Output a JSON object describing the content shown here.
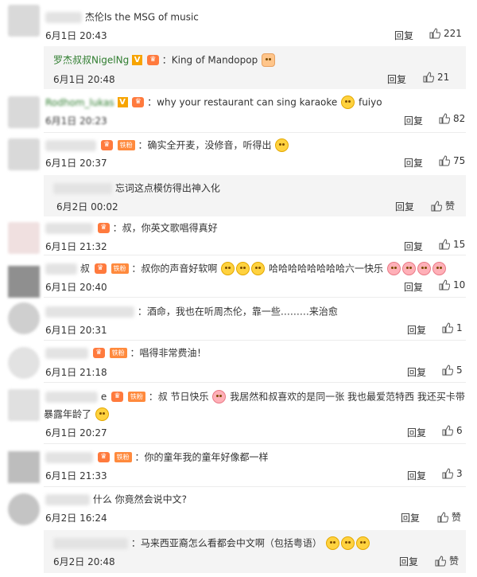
{
  "comments": [
    {
      "text": "杰伦Is the MSG of music",
      "time": "6月1日 20:43",
      "reply_label": "回复",
      "likes": "221"
    },
    {
      "name": "罗杰叔叔NigelNg",
      "text": "：King of Mandopop",
      "time": "6月1日 20:48",
      "reply_label": "回复",
      "likes": "21"
    },
    {
      "name": "Rodhom_lukas",
      "text_a": "：why your restaurant can sing karaoke",
      "text_b": "fuiyo",
      "time": "6月1日 20:23",
      "reply_label": "回复",
      "likes": "82"
    },
    {
      "badge": "铁粉",
      "text": "：确实全开麦，没修音，听得出",
      "time": "6月1日 20:37",
      "reply_label": "回复",
      "likes": "75"
    },
    {
      "text": "忘词这点模仿得出神入化",
      "time": "6月2日 00:02",
      "reply_label": "回复",
      "likes": "赞"
    },
    {
      "text": "：叔，你英文歌唱得真好",
      "time": "6月1日 21:32",
      "reply_label": "回复",
      "likes": "15"
    },
    {
      "name": "叔",
      "badge": "铁粉",
      "text_a": "：叔你的声音好软啊",
      "text_b": "哈哈哈哈哈哈哈哈六一快乐",
      "time": "6月1日 20:40",
      "reply_label": "回复",
      "likes": "10"
    },
    {
      "text": "：酒命，我也在听周杰伦，靠一些………来治愈",
      "time": "6月1日 20:31",
      "reply_label": "回复",
      "likes": "1"
    },
    {
      "badge": "铁粉",
      "text": "：唱得非常费油！",
      "time": "6月1日 21:18",
      "reply_label": "回复",
      "likes": "5"
    },
    {
      "name": "e",
      "badge": "铁粉",
      "text_a": "：叔 节日快乐",
      "text_b": "我居然和叔喜欢的是同一张 我也最爱范特西 我还买卡带",
      "text_c": "暴露年龄了",
      "time": "6月1日 20:27",
      "reply_label": "回复",
      "likes": "6"
    },
    {
      "badge": "铁粉",
      "text": "：你的童年我的童年好像都一样",
      "time": "6月1日 21:33",
      "reply_label": "回复",
      "likes": "3"
    },
    {
      "text": "什么 你竟然会说中文?",
      "time": "6月2日 16:24",
      "reply_label": "回复",
      "likes": "赞"
    },
    {
      "text": "：马来西亚裔怎么看都会中文啊（包括粤语）",
      "time": "6月2日 20:48",
      "reply_label": "回复",
      "likes": "赞"
    }
  ],
  "colors": {
    "sub_bg": "#f4f4f4",
    "name_green": "#2f7d2f",
    "badge_orange": "#ff7a3d"
  }
}
